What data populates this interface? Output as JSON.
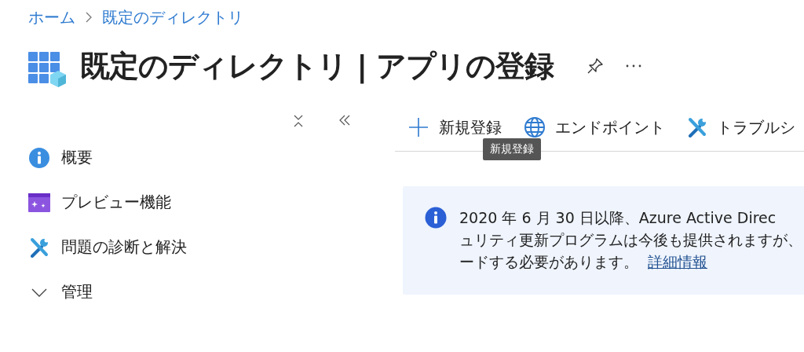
{
  "breadcrumb": [
    {
      "label": "ホーム"
    },
    {
      "label": "既定のディレクトリ"
    }
  ],
  "title": "既定のディレクトリ | アプリの登録",
  "sidebar": {
    "items": [
      {
        "label": "概要",
        "kind": "info"
      },
      {
        "label": "プレビュー機能",
        "kind": "preview"
      },
      {
        "label": "問題の診断と解決",
        "kind": "tools"
      },
      {
        "label": "管理",
        "kind": "group",
        "expanded": true
      }
    ]
  },
  "toolbar": [
    {
      "label": "新規登録",
      "kind": "add"
    },
    {
      "label": "エンドポイント",
      "kind": "globe"
    },
    {
      "label": "トラブルシ",
      "kind": "tools"
    }
  ],
  "tooltip": "新規登録",
  "banner": {
    "lines": [
      "2020 年 6 月 30 日以降、Azure Active Direc",
      "ュリティ更新プログラムは今後も提供されますが、",
      "ードする必要があります。"
    ],
    "link": "詳細情報"
  }
}
